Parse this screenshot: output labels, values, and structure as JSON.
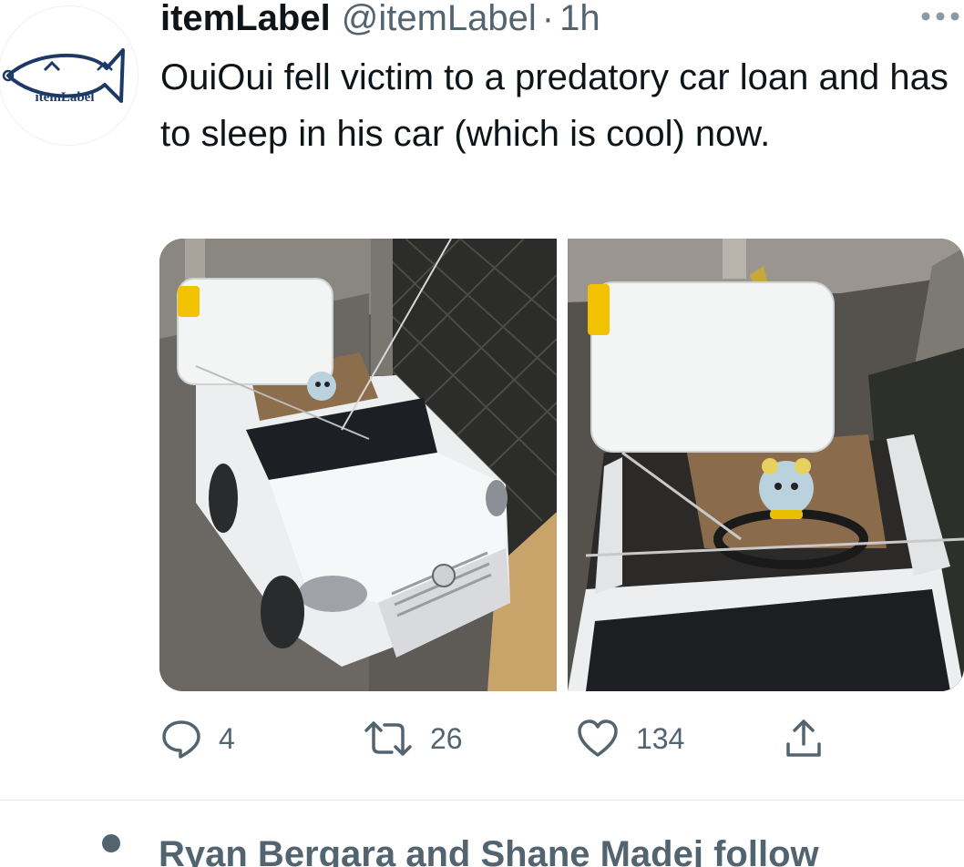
{
  "tweet": {
    "display_name": "itemLabel",
    "handle": "@itemLabel",
    "separator": "·",
    "time": "1h",
    "avatar_logo_text": "itemLabel",
    "text": "OuiOui fell victim to a predatory car loan and has to sleep in his car (which is cool) now."
  },
  "actions": {
    "reply": {
      "icon": "reply-icon",
      "count": "4"
    },
    "retweet": {
      "icon": "retweet-icon",
      "count": "26"
    },
    "like": {
      "icon": "heart-icon",
      "count": "134"
    },
    "share": {
      "icon": "share-icon"
    }
  },
  "social_context": {
    "text": "Ryan Bergara and Shane Madej follow"
  },
  "colors": {
    "text_primary": "#0f1419",
    "text_secondary": "#536471",
    "divider": "#e4e8eb",
    "avatar_logo": "#1d3a66"
  }
}
